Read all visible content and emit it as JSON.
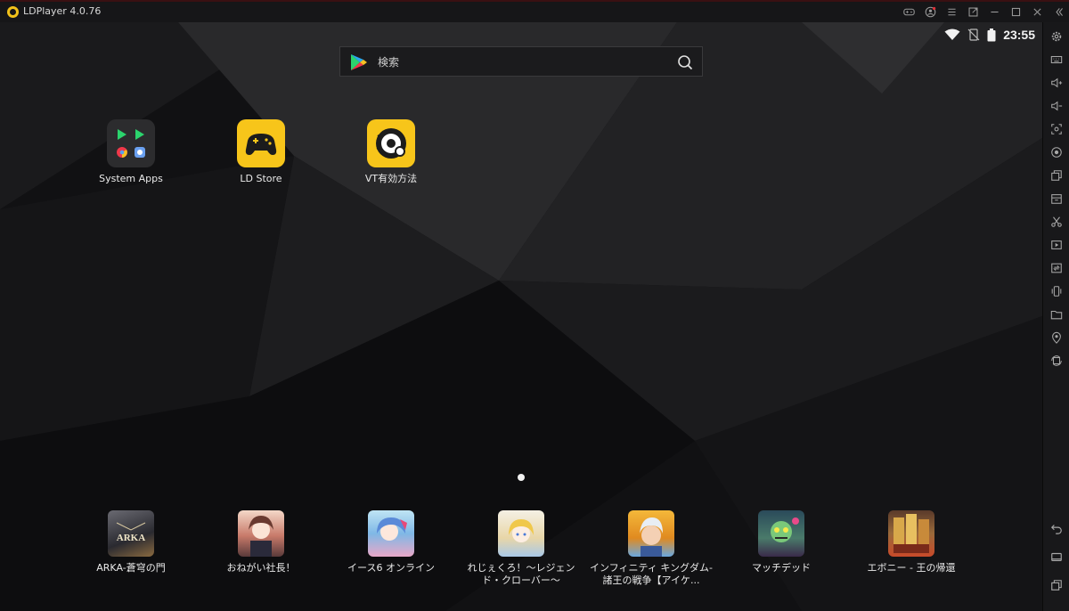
{
  "window": {
    "title": "LDPlayer 4.0.76"
  },
  "status_bar": {
    "time": "23:55"
  },
  "search": {
    "placeholder": "検索"
  },
  "desktop_apps": [
    {
      "label": "System Apps"
    },
    {
      "label": "LD Store"
    },
    {
      "label": "VT有効方法"
    }
  ],
  "dock_apps": [
    {
      "label": "ARKA-蒼穹の門"
    },
    {
      "label": "おねがい社長！"
    },
    {
      "label": "イース6 オンライン"
    },
    {
      "label": "れじぇくろ！～レジェンド・クローバー～"
    },
    {
      "label": "インフィニティ キングダム-諸王の戦争【アイケ..."
    },
    {
      "label": "マッチデッド"
    },
    {
      "label": "エボニー - 王の帰還"
    }
  ],
  "colors": {
    "accent": "#f2c21a",
    "background": "#101012",
    "sidebar": "#18181a"
  },
  "icons": {
    "titlebar": [
      "gamepad-icon",
      "account-icon",
      "menu-icon",
      "popout-icon",
      "minimize-icon",
      "maximize-icon",
      "close-icon",
      "collapse-icon"
    ],
    "sidebar": [
      "settings-icon",
      "keyboard-icon",
      "volume-up-icon",
      "volume-down-icon",
      "screenshot-icon",
      "record-icon",
      "multi-instance-icon",
      "apk-install-icon",
      "scissors-icon",
      "video-icon",
      "sync-icon",
      "shake-icon",
      "folder-icon",
      "location-icon",
      "rotate-icon",
      "back-icon",
      "home-icon",
      "recent-apps-icon"
    ]
  }
}
